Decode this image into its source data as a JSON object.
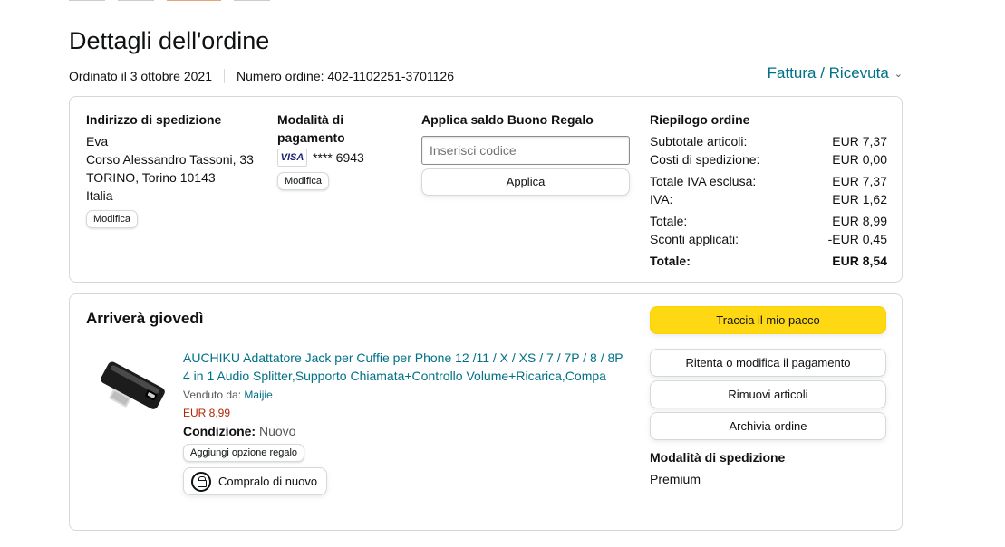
{
  "page": {
    "title": "Dettagli dell'ordine",
    "ordered_on": "Ordinato il 3 ottobre 2021",
    "order_number": "Numero ordine: 402-1102251-3701126",
    "invoice_link": "Fattura / Ricevuta"
  },
  "shipping_address": {
    "title": "Indirizzo di spedizione",
    "name": "Eva",
    "street": "Corso Alessandro Tassoni, 33",
    "city": "TORINO, Torino 10143",
    "country": "Italia",
    "edit_label": "Modifica"
  },
  "payment": {
    "title": "Modalità di pagamento",
    "card_brand": "VISA",
    "card_number": "**** 6943",
    "edit_label": "Modifica"
  },
  "gift_card": {
    "title": "Applica saldo Buono Regalo",
    "placeholder": "Inserisci codice",
    "apply_label": "Applica"
  },
  "summary": {
    "title": "Riepilogo ordine",
    "rows": [
      {
        "label": "Subtotale articoli:",
        "value": "EUR 7,37"
      },
      {
        "label": "Costi di spedizione:",
        "value": "EUR 0,00"
      },
      {
        "label": "Totale IVA esclusa:",
        "value": "EUR 7,37"
      },
      {
        "label": "IVA:",
        "value": "EUR 1,62"
      },
      {
        "label": "Totale:",
        "value": "EUR 8,99"
      },
      {
        "label": "Sconti applicati:",
        "value": "-EUR 0,45"
      },
      {
        "label": "Totale:",
        "value": "EUR 8,54"
      }
    ]
  },
  "delivery": {
    "title": "Arriverà giovedì",
    "product": {
      "title": "AUCHIKU Adattatore Jack per Cuffie per Phone 12 /11 / X / XS / 7 / 7P / 8 / 8P 4 in 1 Audio Splitter,Supporto Chiamata+Controllo Volume+Ricarica,Compa",
      "sold_by_label": "Venduto da:",
      "seller": "Maijie",
      "price": "EUR 8,99",
      "condition_label": "Condizione:",
      "condition_value": "Nuovo",
      "gift_option_label": "Aggiungi opzione regalo",
      "buy_again_label": "Compralo di nuovo"
    },
    "actions": {
      "track": "Traccia il mio pacco",
      "retry_payment": "Ritenta o modifica il pagamento",
      "remove_items": "Rimuovi articoli",
      "archive": "Archivia ordine"
    },
    "shipping_method_title": "Modalità di spedizione",
    "shipping_method_value": "Premium"
  },
  "colors": {
    "link": "#007185",
    "price": "#b12704",
    "primary_button": "#ffd814",
    "border": "#d5d9d9"
  }
}
